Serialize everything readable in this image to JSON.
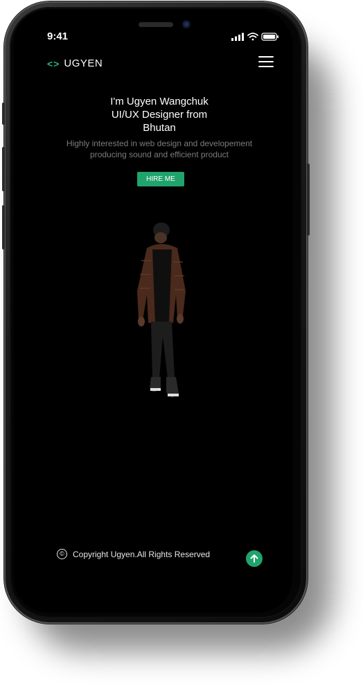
{
  "status_bar": {
    "time": "9:41"
  },
  "nav": {
    "logo_icon": "<>",
    "logo_text": "UGYEN"
  },
  "hero": {
    "title_lines": [
      "I'm Ugyen Wangchuk",
      "UI/UX Designer from",
      "Bhutan"
    ],
    "subtitle_lines": [
      "Highly interested in web design and developement",
      "producing sound and efficient product"
    ],
    "cta_label": "HIRE ME"
  },
  "footer": {
    "copyright_symbol": "©",
    "copyright_text": "Copyright Ugyen.All Rights Reserved"
  },
  "colors": {
    "accent": "#21a36c",
    "background": "#000000",
    "muted_text": "#7c7c7c"
  },
  "icons": [
    "code-icon",
    "menu-icon",
    "signal-icon",
    "wifi-icon",
    "battery-icon",
    "copyright-icon",
    "arrow-up-icon"
  ]
}
